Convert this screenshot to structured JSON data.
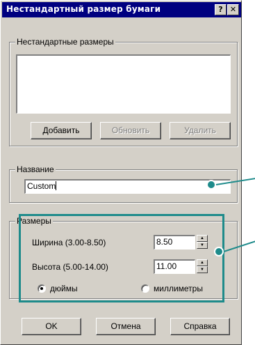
{
  "window": {
    "title": "Нестандартный размер бумаги",
    "help_button": "?",
    "close_button": "✕"
  },
  "custom_sizes": {
    "group_label": "Нестандартные размеры",
    "items": [],
    "add_label": "Добавить",
    "update_label": "Обновить",
    "delete_label": "Удалить"
  },
  "name": {
    "group_label": "Название",
    "value": "Custom"
  },
  "sizes": {
    "group_label": "Размеры",
    "width_label": "Ширина (3.00-8.50)",
    "width_value": "8.50",
    "height_label": "Высота (5.00-14.00)",
    "height_value": "11.00",
    "unit_inches": "дюймы",
    "unit_mm": "миллиметры",
    "selected_unit": "inches"
  },
  "footer": {
    "ok_label": "OK",
    "cancel_label": "Отмена",
    "help_label": "Справка"
  },
  "colors": {
    "titlebar": "#000080",
    "dialog_face": "#d4d0c8",
    "callout": "#1e8b8b"
  }
}
